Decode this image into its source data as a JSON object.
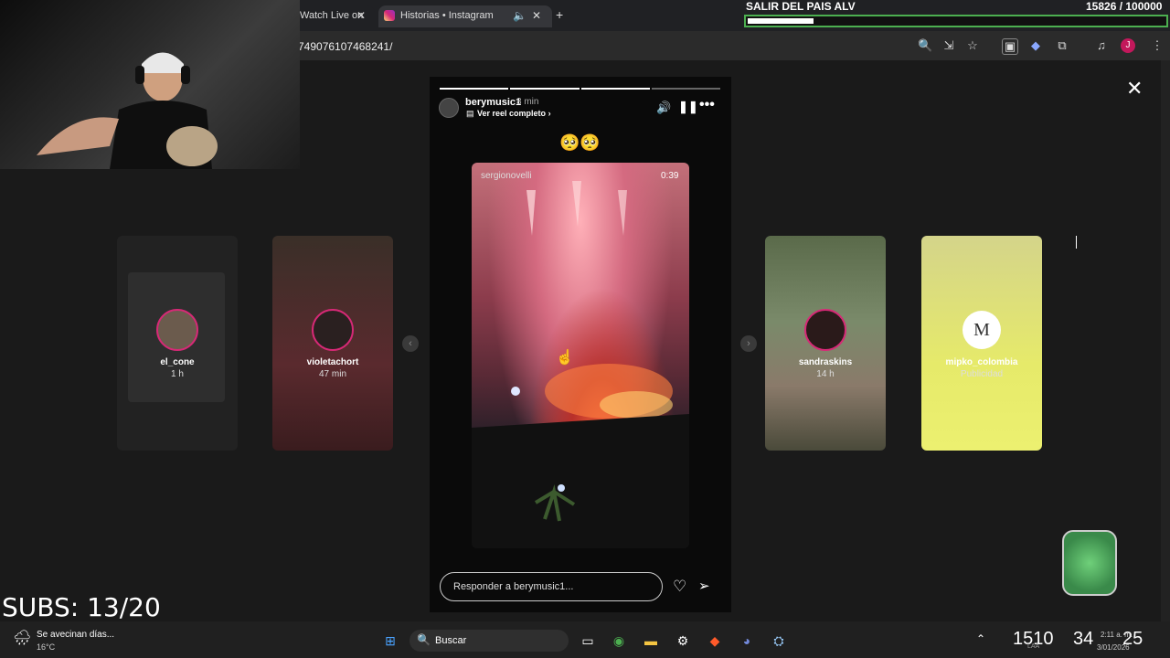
{
  "browser": {
    "tabs": [
      {
        "label": "Watch Live on"
      },
      {
        "label": "Historias • Instagram"
      }
    ],
    "url": "749076107468241/",
    "new_tab": "+"
  },
  "overlay": {
    "goal_title": "SALIR DEL PAIS ALV",
    "goal_count": "15826 / 100000",
    "goal_fraction": 0.158,
    "subs": "SUBS: 13/20"
  },
  "story": {
    "username": "berymusic1",
    "time": "8 min",
    "reel_link": "Ver reel completo",
    "reel_chevron": "›",
    "caption_emoji": "🥺🥺",
    "video_user": "sergionovelli",
    "video_duration": "0:39",
    "reply_placeholder": "Responder a berymusic1...",
    "close": "✕",
    "progress_segments": 4,
    "progress_done_fraction": 0.75
  },
  "side_stories": [
    {
      "name": "el_cone",
      "time": "1 h"
    },
    {
      "name": "violetachort",
      "time": "47 min"
    },
    {
      "name": "sandraskins",
      "time": "14 h"
    },
    {
      "name": "mipko_colombia",
      "time": "Publicidad",
      "logo": "M"
    }
  ],
  "colors": {
    "goal_border": "#4caf50",
    "story_ring": "#d62976"
  },
  "taskbar": {
    "weather_text": "Se avecinan días...",
    "temperature": "16°C",
    "search": "Buscar",
    "widget_a": "1510",
    "widget_b": "34",
    "widget_c": "25",
    "clock_time": "2:11 a. m.",
    "clock_date": "3/01/2026",
    "clock_lang": "LAA"
  }
}
